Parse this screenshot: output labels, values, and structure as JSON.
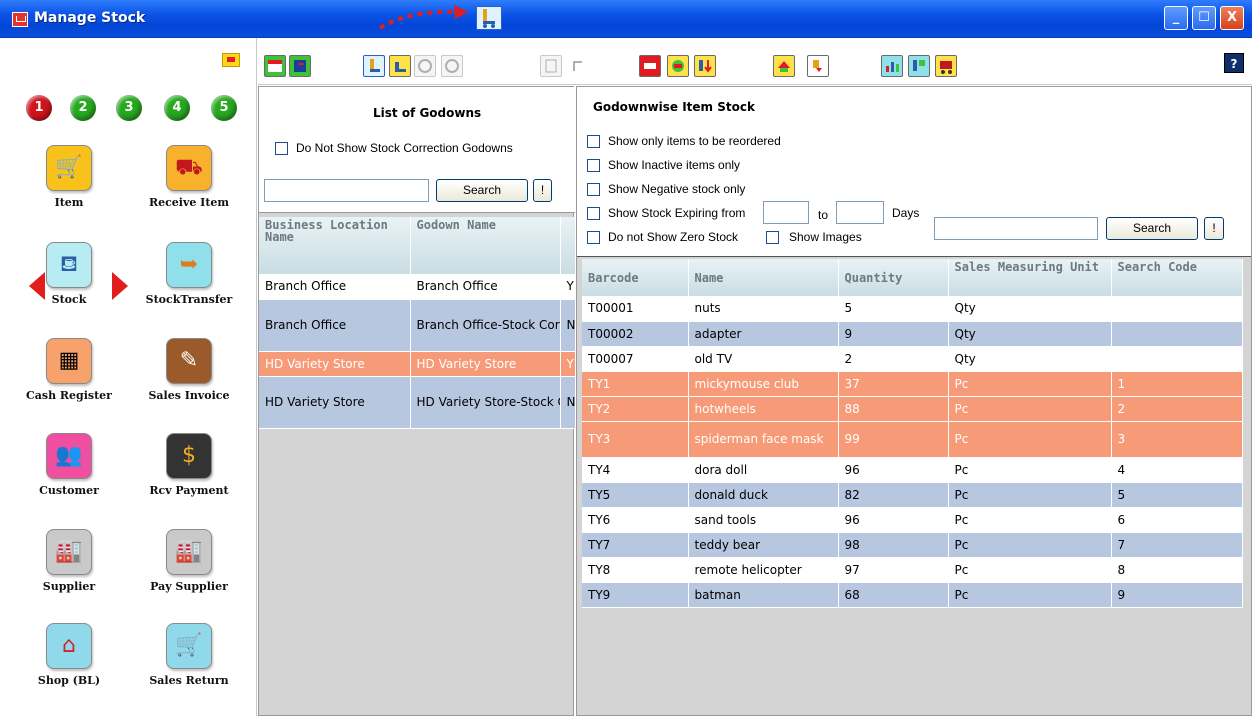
{
  "window": {
    "title": "Manage Stock",
    "buttons": {
      "minimize": "_",
      "maximize": "☐",
      "close": "X"
    }
  },
  "launcher": {
    "numbers": [
      "1",
      "2",
      "3",
      "4",
      "5"
    ],
    "tiles": [
      {
        "label": "Item",
        "icon": "shopping-cart-icon",
        "color": "#f8c21a"
      },
      {
        "label": "Receive Item",
        "icon": "truck-icon",
        "color": "#f8b12a"
      },
      {
        "label": "Stock",
        "icon": "stock-trolley-icon",
        "color": "#b7ecf3"
      },
      {
        "label": "StockTransfer",
        "icon": "stock-transfer-icon",
        "color": "#8fe0ea"
      },
      {
        "label": "Cash Register",
        "icon": "cash-register-icon",
        "color": "#f6a26a"
      },
      {
        "label": "Sales Invoice",
        "icon": "invoice-icon",
        "color": "#9a5a2a"
      },
      {
        "label": "Customer",
        "icon": "customers-icon",
        "color": "#f04fa1"
      },
      {
        "label": "Rcv Payment",
        "icon": "payment-icon",
        "color": "#333333"
      },
      {
        "label": "Supplier",
        "icon": "factory-icon",
        "color": "#c9c9c9"
      },
      {
        "label": "Pay Supplier",
        "icon": "pay-factory-icon",
        "color": "#c9c9c9"
      },
      {
        "label": "Shop (BL)",
        "icon": "shop-icon",
        "color": "#8fd9ea"
      },
      {
        "label": "Sales Return",
        "icon": "cart-return-icon",
        "color": "#8fd9ea"
      }
    ]
  },
  "godowns": {
    "title": "List of Godowns",
    "hide_correction_label": "Do Not Show Stock Correction Godowns",
    "search_value": "",
    "search_button": "Search",
    "clear_button": "!",
    "columns": [
      "Business Location Name",
      "Godown Name"
    ],
    "rows": [
      {
        "location": "Branch Office",
        "godown": "Branch Office",
        "extra": "Y",
        "style": "white"
      },
      {
        "location": "Branch Office",
        "godown": "Branch Office-Stock Correction",
        "extra": "N",
        "style": "blue"
      },
      {
        "location": "HD Variety Store",
        "godown": "HD Variety Store",
        "extra": "Y",
        "style": "sel"
      },
      {
        "location": "HD Variety Store",
        "godown": "HD Variety Store-Stock Correction",
        "extra": "N",
        "style": "blue"
      }
    ]
  },
  "stock": {
    "title": "Godownwise Item Stock",
    "filters": {
      "reorder": "Show only items to be reordered",
      "inactive": "Show Inactive items only",
      "negative": "Show Negative stock only",
      "expiring": "Show Stock Expiring from",
      "to": "to",
      "days": "Days",
      "zero": "Do not Show Zero Stock",
      "images": "Show Images"
    },
    "search_value": "",
    "search_button": "Search",
    "clear_button": "!",
    "columns": [
      "Barcode",
      "Name",
      "Quantity",
      "Sales Measuring Unit",
      "Search Code"
    ],
    "rows": [
      {
        "barcode": "T00001",
        "name": "nuts",
        "qty": "5",
        "unit": "Qty",
        "code": "",
        "style": "white"
      },
      {
        "barcode": "T00002",
        "name": "adapter",
        "qty": "9",
        "unit": "Qty",
        "code": "",
        "style": "blue"
      },
      {
        "barcode": "T00007",
        "name": "old TV",
        "qty": "2",
        "unit": "Qty",
        "code": "",
        "style": "white"
      },
      {
        "barcode": "TY1",
        "name": "mickymouse club",
        "qty": "37",
        "unit": "Pc",
        "code": "1",
        "style": "sel"
      },
      {
        "barcode": "TY2",
        "name": "hotwheels",
        "qty": "88",
        "unit": "Pc",
        "code": "2",
        "style": "sel"
      },
      {
        "barcode": "TY3",
        "name": "spiderman face mask",
        "qty": "99",
        "unit": "Pc",
        "code": "3",
        "style": "sel"
      },
      {
        "barcode": "TY4",
        "name": "dora doll",
        "qty": "96",
        "unit": "Pc",
        "code": "4",
        "style": "white"
      },
      {
        "barcode": "TY5",
        "name": "donald duck",
        "qty": "82",
        "unit": "Pc",
        "code": "5",
        "style": "blue"
      },
      {
        "barcode": "TY6",
        "name": "sand tools",
        "qty": "96",
        "unit": "Pc",
        "code": "6",
        "style": "white"
      },
      {
        "barcode": "TY7",
        "name": "teddy bear",
        "qty": "98",
        "unit": "Pc",
        "code": "7",
        "style": "blue"
      },
      {
        "barcode": "TY8",
        "name": "remote helicopter",
        "qty": "97",
        "unit": "Pc",
        "code": "8",
        "style": "white"
      },
      {
        "barcode": "TY9",
        "name": "batman",
        "qty": "68",
        "unit": "Pc",
        "code": "9",
        "style": "blue"
      }
    ]
  },
  "toolbar": {
    "help": "?",
    "buttons": [
      {
        "icon": "grid-view-icon",
        "color": "#3fc23a"
      },
      {
        "icon": "report-view-icon",
        "color": "#3fc23a"
      },
      {
        "icon": "stock-icon",
        "color": "#dff2ff"
      },
      {
        "icon": "stock-low-icon",
        "color": "#ffe24a"
      },
      {
        "icon": "refresh-icon",
        "color": "#f5f5f5"
      },
      {
        "icon": "undo-icon",
        "color": "#f5f5f5"
      },
      {
        "icon": "list-disabled-icon",
        "color": "#f5f5f5"
      },
      {
        "icon": "export-disabled-icon",
        "color": "#f5f5f5"
      },
      {
        "icon": "stock-correction-icon",
        "color": "#e11b22"
      },
      {
        "icon": "transfer-icon",
        "color": "#ffe24a"
      },
      {
        "icon": "stock-in-icon",
        "color": "#ffe24a"
      },
      {
        "icon": "return-icon",
        "color": "#ffe24a"
      },
      {
        "icon": "stock-out-icon",
        "color": "#ffffff"
      },
      {
        "icon": "chart-icon",
        "color": "#8fe0ea"
      },
      {
        "icon": "price-icon",
        "color": "#8fe0ea"
      },
      {
        "icon": "cart-icon",
        "color": "#ffe24a"
      }
    ]
  }
}
